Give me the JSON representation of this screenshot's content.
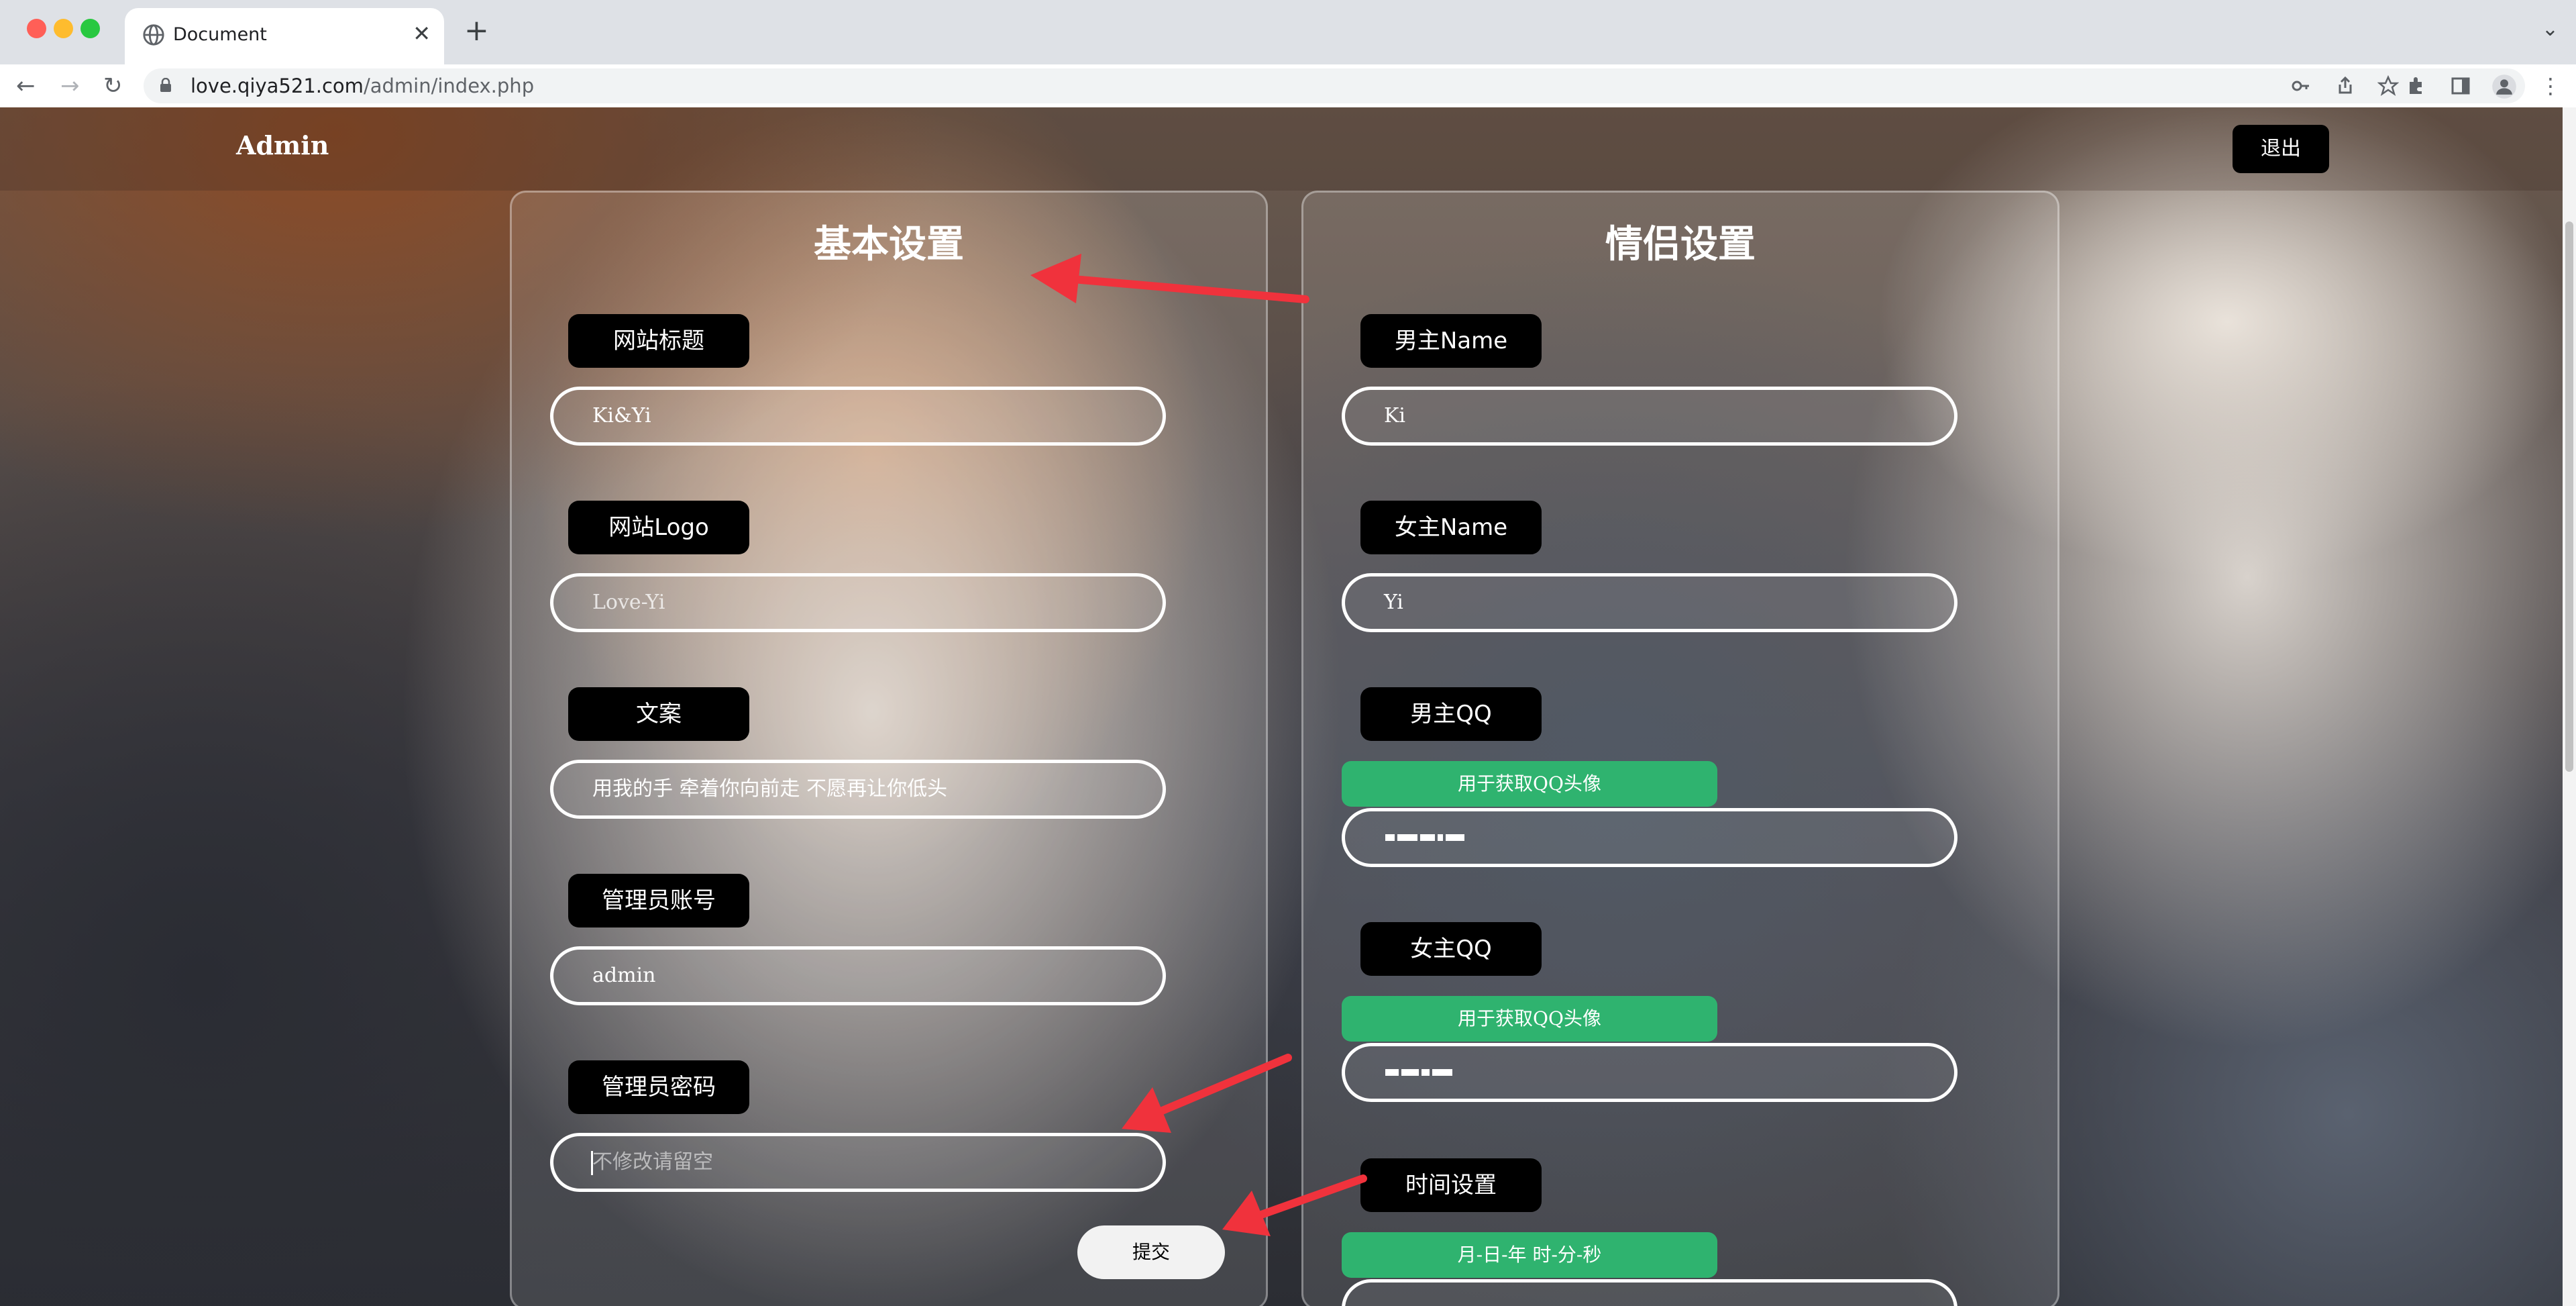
{
  "browser": {
    "tab_title": "Document",
    "url_host": "love.qiya521.com",
    "url_path": "/admin/index.php"
  },
  "header": {
    "brand": "Admin",
    "logout_label": "退出"
  },
  "basic_settings": {
    "title": "基本设置",
    "fields": [
      {
        "label": "网站标题",
        "value": "Ki&Yi"
      },
      {
        "label": "网站Logo",
        "value": "Love-Yi"
      },
      {
        "label": "文案",
        "value": "用我的手 牵着你向前走 不愿再让你低头"
      },
      {
        "label": "管理员账号",
        "value": "admin"
      },
      {
        "label": "管理员密码",
        "placeholder": "不修改请留空"
      }
    ],
    "submit_label": "提交"
  },
  "couple_settings": {
    "title": "情侣设置",
    "male_name_label": "男主Name",
    "male_name_value": "Ki",
    "female_name_label": "女主Name",
    "female_name_value": "Yi",
    "male_qq_label": "男主QQ",
    "male_qq_hint": "用于获取QQ头像",
    "female_qq_label": "女主QQ",
    "female_qq_hint": "用于获取QQ头像",
    "time_label": "时间设置",
    "time_hint": "月-日-年 时-分-秒"
  },
  "colors": {
    "accent_green": "#2fb36f",
    "annotation_red": "#f0323c",
    "pill_black": "#000000"
  },
  "icons": [
    "globe-icon",
    "close-icon",
    "plus-icon",
    "back-icon",
    "forward-icon",
    "reload-icon",
    "lock-icon",
    "key-icon",
    "share-icon",
    "star-icon",
    "extensions-icon",
    "sidebar-icon",
    "profile-icon",
    "more-icon"
  ]
}
